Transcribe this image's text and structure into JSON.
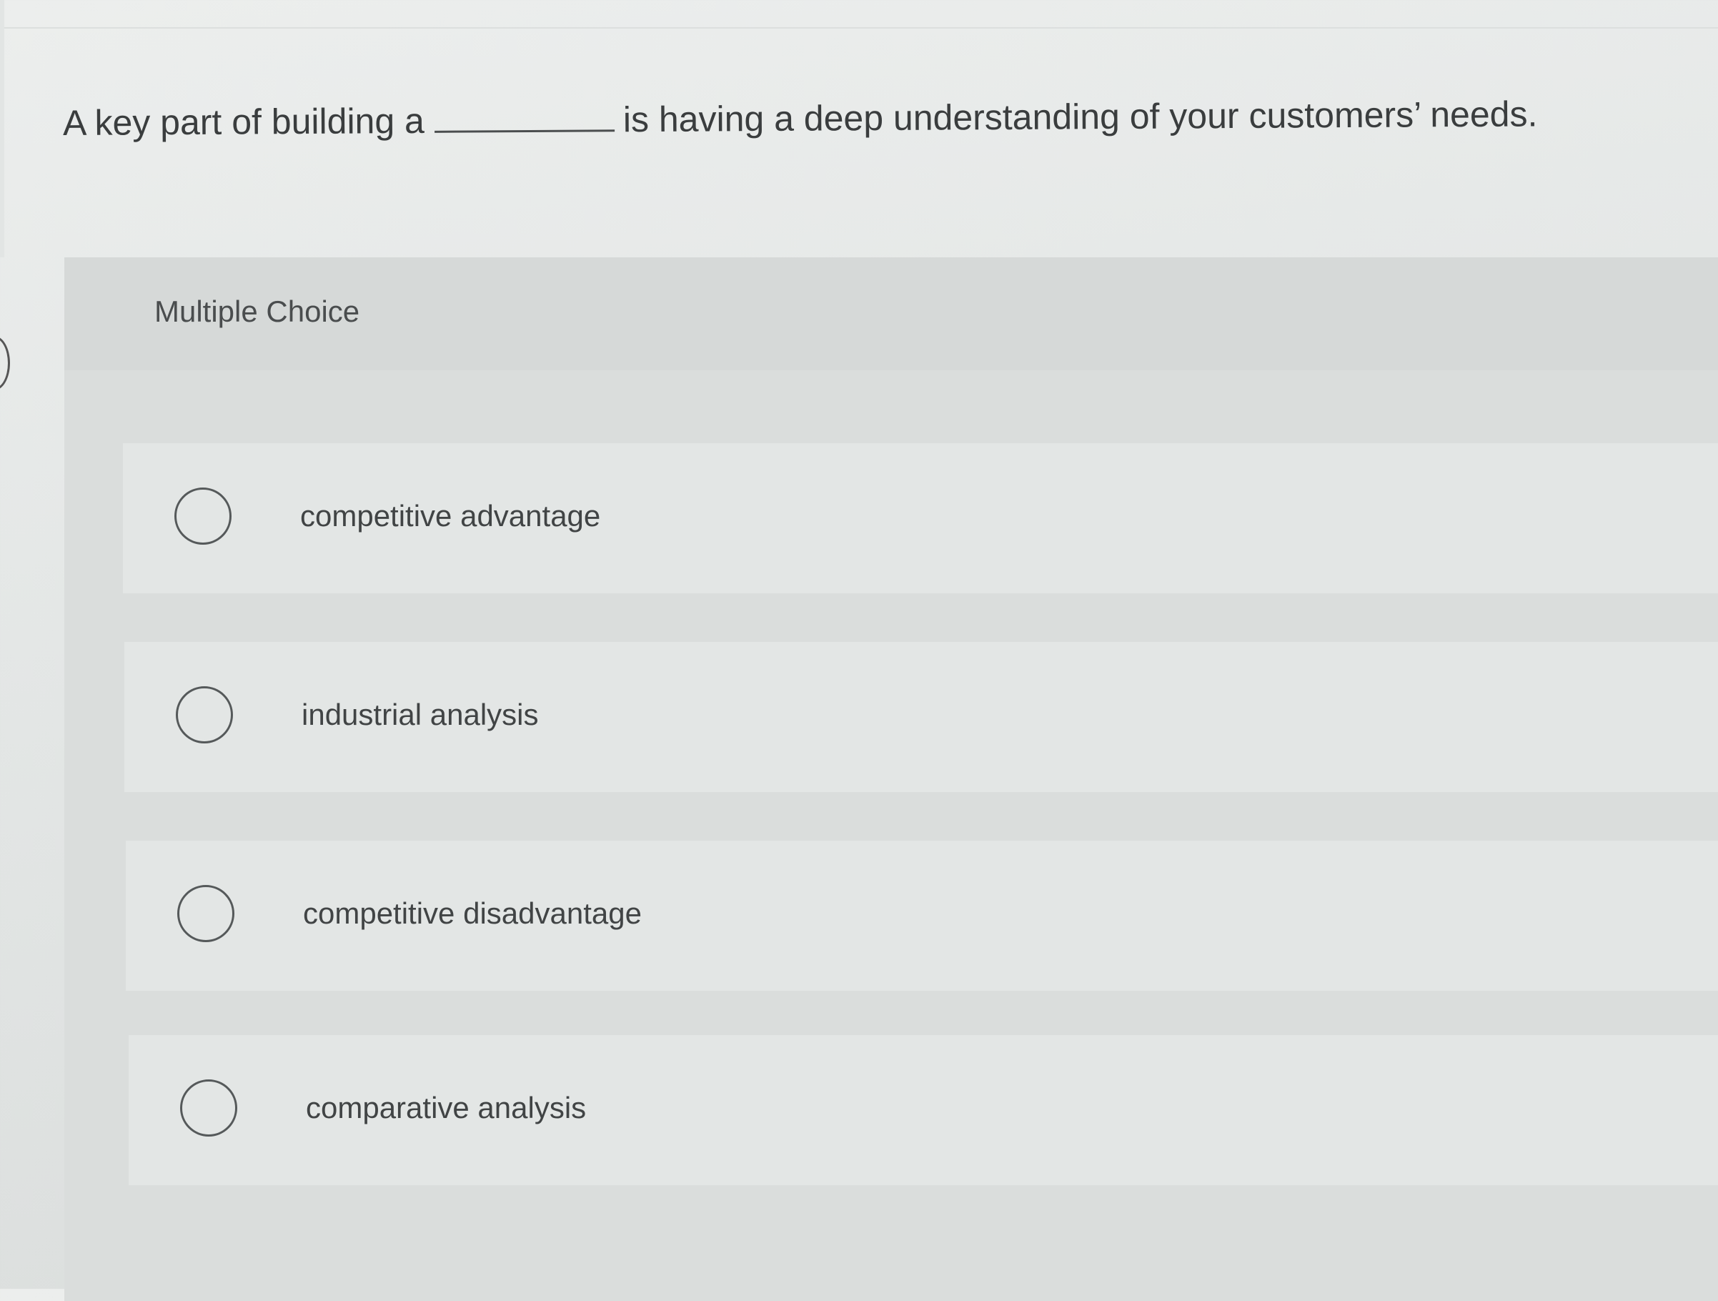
{
  "question": {
    "text_before_blank": "A key part of building a",
    "text_after_blank": "is having a deep understanding of your customers’ needs."
  },
  "question_type_label": "Multiple Choice",
  "options": [
    {
      "label": "competitive advantage",
      "selected": false
    },
    {
      "label": "industrial analysis",
      "selected": false
    },
    {
      "label": "competitive disadvantage",
      "selected": false
    },
    {
      "label": "comparative analysis",
      "selected": false
    }
  ]
}
